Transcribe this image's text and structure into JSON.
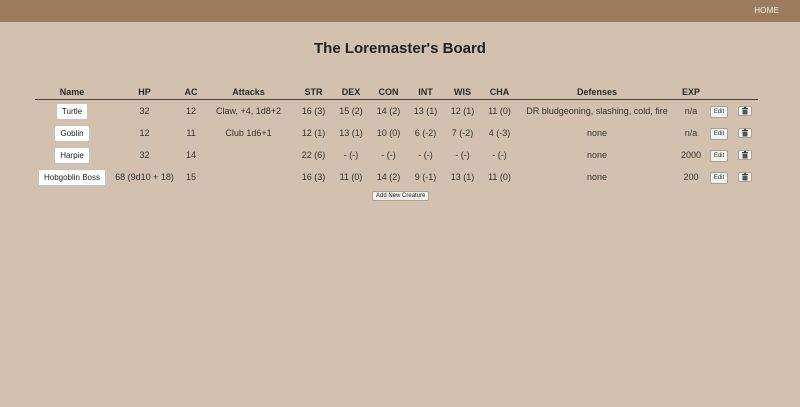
{
  "nav": {
    "home_label": "HOME"
  },
  "page": {
    "title": "The Loremaster's Board"
  },
  "table": {
    "headers": {
      "name": "Name",
      "hp": "HP",
      "ac": "AC",
      "attacks": "Attacks",
      "str": "STR",
      "dex": "DEX",
      "con": "CON",
      "int": "INT",
      "wis": "WIS",
      "cha": "CHA",
      "defenses": "Defenses",
      "exp": "EXP"
    },
    "rows": [
      {
        "name": "Turtle",
        "hp": "32",
        "ac": "12",
        "attacks": "Claw, +4, 1d8+2",
        "str": "16 (3)",
        "dex": "15 (2)",
        "con": "14 (2)",
        "int": "13 (1)",
        "wis": "12 (1)",
        "cha": "11 (0)",
        "defenses": "DR bludgeoning, slashing, cold, fire",
        "exp": "n/a"
      },
      {
        "name": "Goblin",
        "hp": "12",
        "ac": "11",
        "attacks": "Club 1d6+1",
        "str": "12 (1)",
        "dex": "13 (1)",
        "con": "10 (0)",
        "int": "6 (-2)",
        "wis": "7 (-2)",
        "cha": "4 (-3)",
        "defenses": "none",
        "exp": "n/a"
      },
      {
        "name": "Harpie",
        "hp": "32",
        "ac": "14",
        "attacks": "",
        "str": "22 (6)",
        "dex": "- (-)",
        "con": "- (-)",
        "int": "- (-)",
        "wis": "- (-)",
        "cha": "- (-)",
        "defenses": "none",
        "exp": "2000"
      },
      {
        "name": "Hobgoblin Boss",
        "hp": "68 (9d10 + 18)",
        "ac": "15",
        "attacks": "",
        "str": "16 (3)",
        "dex": "11 (0)",
        "con": "14 (2)",
        "int": "9 (-1)",
        "wis": "13 (1)",
        "cha": "11 (0)",
        "defenses": "none",
        "exp": "200"
      }
    ],
    "edit_label": "Edit",
    "delete_icon": "trash-icon"
  },
  "actions": {
    "add_label": "Add New Creature"
  },
  "colors": {
    "background": "#d2c1ae",
    "topbar": "#9b7c5c",
    "button": "#ffffff"
  }
}
